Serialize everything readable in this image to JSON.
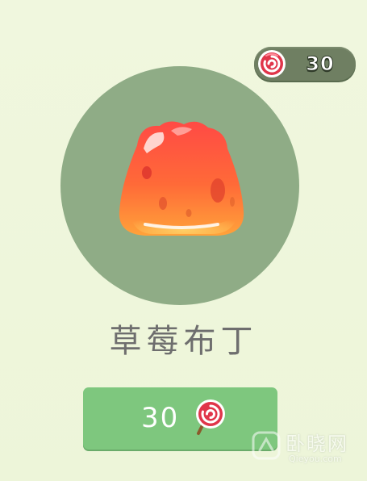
{
  "currency": {
    "icon": "lollipop-candy-icon",
    "count": "30"
  },
  "item": {
    "name": "草莓布丁",
    "icon": "strawberry-jelly-pudding-icon"
  },
  "buy_button": {
    "price": "30",
    "currency_icon": "lollipop-candy-icon"
  },
  "watermark": {
    "title": "卧晓网",
    "url": "Qieyou.com"
  },
  "colors": {
    "background": "#eff6dc",
    "circle": "#8fac86",
    "pill": "#6f7f62",
    "button": "#7ec77e",
    "name_text": "#6e6e6e",
    "candy_red": "#e0354a"
  }
}
